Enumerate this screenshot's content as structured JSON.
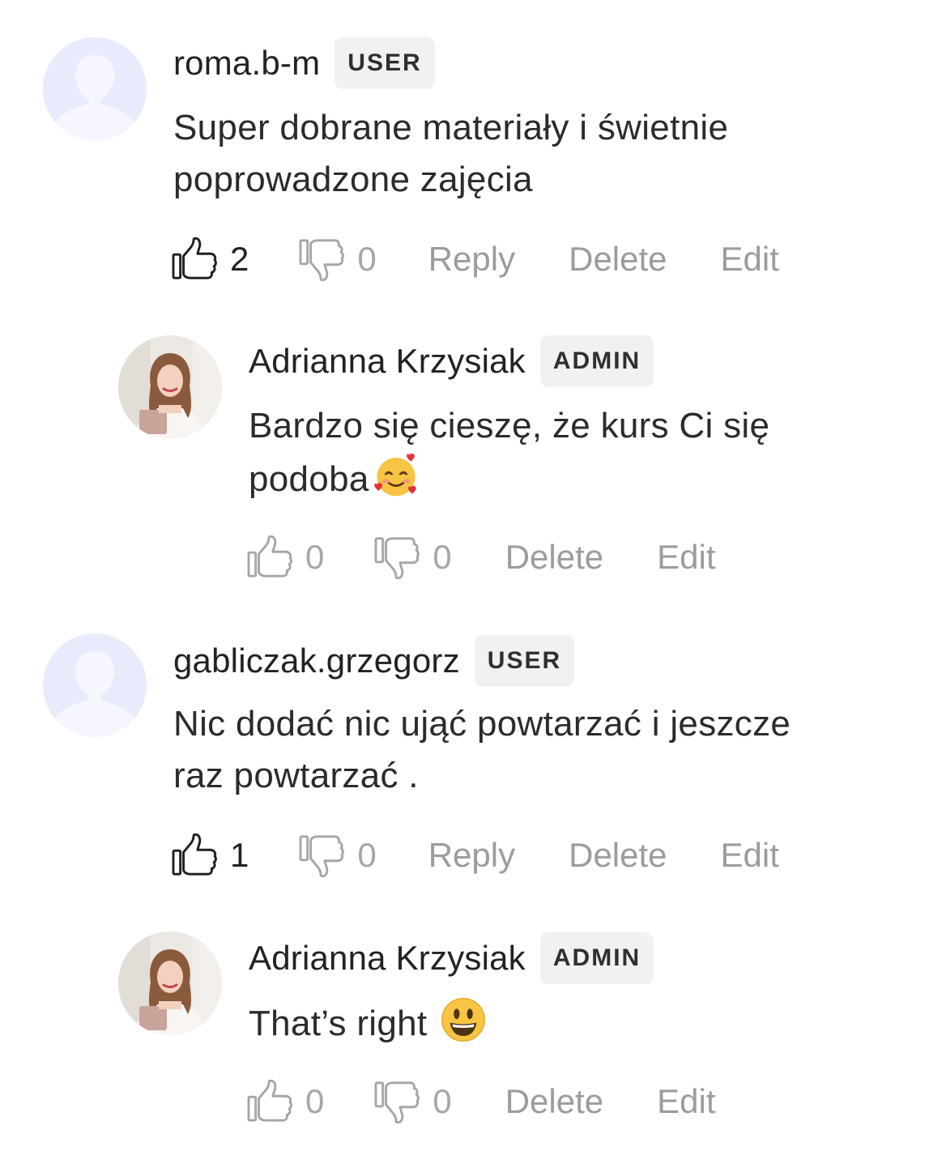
{
  "comments": [
    {
      "author": "roma.b-m",
      "role": "USER",
      "text": "Super dobrane materiały i świetnie\npoprowadzone zajęcia",
      "likes": "2",
      "dislikes": "0",
      "reply": "Reply",
      "delete": "Delete",
      "edit": "Edit",
      "avatar": "default-avatar-icon"
    },
    {
      "author": "Adrianna Krzysiak",
      "role": "ADMIN",
      "text": "Bardzo się cieszę, że kurs Ci się\npodoba",
      "emoji": "smiling-face-with-hearts",
      "likes": "0",
      "dislikes": "0",
      "delete": "Delete",
      "edit": "Edit",
      "avatar": "profile-photo"
    },
    {
      "author": "gabliczak.grzegorz",
      "role": "USER",
      "text": "Nic dodać nic ująć powtarzać i jeszcze\nraz powtarzać .",
      "likes": "1",
      "dislikes": "0",
      "reply": "Reply",
      "delete": "Delete",
      "edit": "Edit",
      "avatar": "default-avatar-icon"
    },
    {
      "author": "Adrianna Krzysiak",
      "role": "ADMIN",
      "text": "That’s right",
      "emoji": "grinning-face",
      "likes": "0",
      "dislikes": "0",
      "delete": "Delete",
      "edit": "Edit",
      "avatar": "profile-photo"
    }
  ],
  "colors": {
    "avatar_placeholder_bg": "#e8ebfb",
    "avatar_placeholder_figure": "#f5f6fe",
    "badge_bg": "#f1f1f3",
    "action_text": "#9c9c9c",
    "count_active": "#222222",
    "count_muted": "#a6a6a6"
  }
}
